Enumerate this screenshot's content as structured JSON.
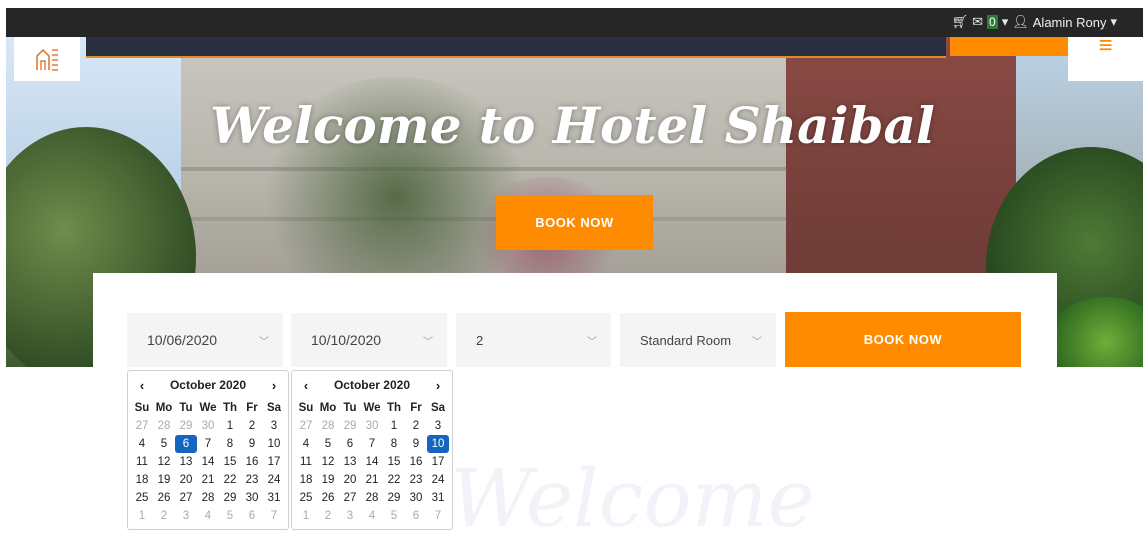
{
  "topbar": {
    "cart_icon": "cart-icon",
    "mail_icon": "envelope-icon",
    "cart_count": "0",
    "user_icon": "user-icon",
    "user_name": "Alamin Rony",
    "caret": "▾"
  },
  "brand": {
    "logo": "hotel-logo",
    "menu_icon": "hamburger-icon"
  },
  "hero": {
    "title": "Welcome to Hotel Shaibal",
    "book_label": "BOOK NOW"
  },
  "booking": {
    "checkin_value": "10/06/2020",
    "checkout_value": "10/10/2020",
    "guests_value": "2",
    "room_value": "Standard Room",
    "book_label": "BOOK NOW"
  },
  "section_heading": "Welcome",
  "calendars": [
    {
      "month": "October 2020",
      "prev": "‹",
      "next": "›",
      "day_names": [
        "Su",
        "Mo",
        "Tu",
        "We",
        "Th",
        "Fr",
        "Sa"
      ],
      "weeks": [
        [
          "27",
          "28",
          "29",
          "30",
          "1",
          "2",
          "3"
        ],
        [
          "4",
          "5",
          "6",
          "7",
          "8",
          "9",
          "10"
        ],
        [
          "11",
          "12",
          "13",
          "14",
          "15",
          "16",
          "17"
        ],
        [
          "18",
          "19",
          "20",
          "21",
          "22",
          "23",
          "24"
        ],
        [
          "25",
          "26",
          "27",
          "28",
          "29",
          "30",
          "31"
        ],
        [
          "1",
          "2",
          "3",
          "4",
          "5",
          "6",
          "7"
        ]
      ],
      "selected": "6"
    },
    {
      "month": "October 2020",
      "prev": "‹",
      "next": "›",
      "day_names": [
        "Su",
        "Mo",
        "Tu",
        "We",
        "Th",
        "Fr",
        "Sa"
      ],
      "weeks": [
        [
          "27",
          "28",
          "29",
          "30",
          "1",
          "2",
          "3"
        ],
        [
          "4",
          "5",
          "6",
          "7",
          "8",
          "9",
          "10"
        ],
        [
          "11",
          "12",
          "13",
          "14",
          "15",
          "16",
          "17"
        ],
        [
          "18",
          "19",
          "20",
          "21",
          "22",
          "23",
          "24"
        ],
        [
          "25",
          "26",
          "27",
          "28",
          "29",
          "30",
          "31"
        ],
        [
          "1",
          "2",
          "3",
          "4",
          "5",
          "6",
          "7"
        ]
      ],
      "selected": "10"
    }
  ],
  "colors": {
    "accent": "#ff8c00",
    "topbar": "#262626",
    "selected_day": "#1565c0"
  }
}
